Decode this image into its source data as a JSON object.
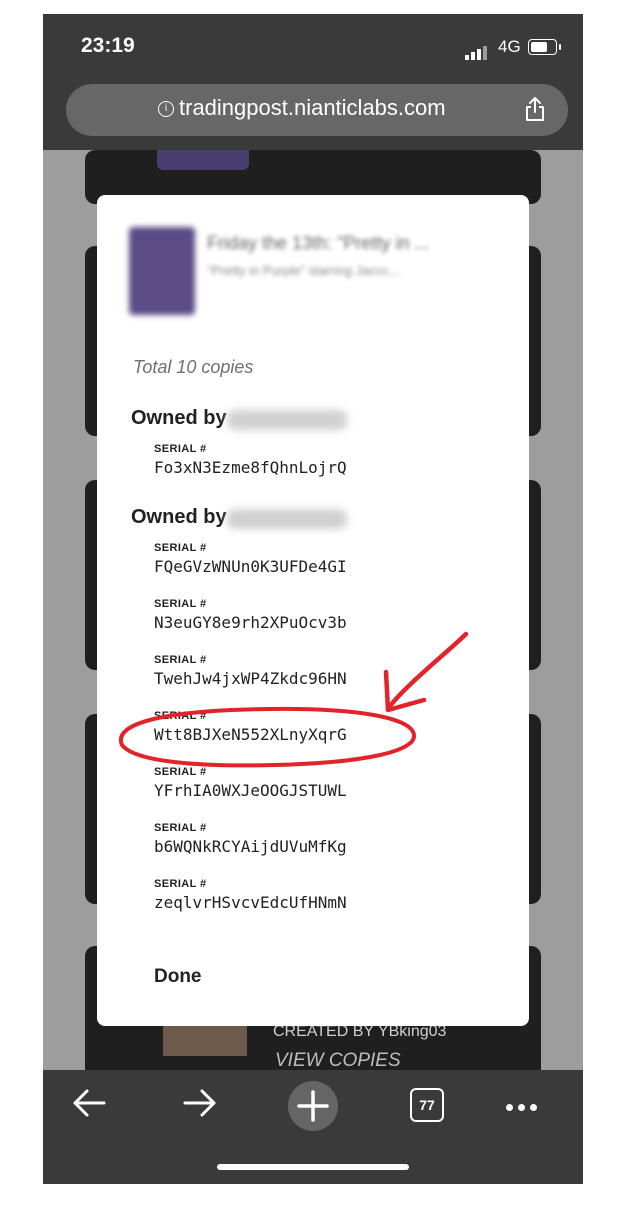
{
  "status_bar": {
    "time": "23:19",
    "network": "4G"
  },
  "browser": {
    "url": "tradingpost.nianticlabs.com"
  },
  "background_list": {
    "created_by": "CREATED BY YBking03",
    "view_copies": "VIEW COPIES"
  },
  "modal": {
    "item_title": "Friday the 13th: \"Pretty in ...",
    "item_subtitle": "\"Pretty in Purple\" starring Jaccc...",
    "total_copies": "Total 10 copies",
    "owners": [
      {
        "label": "Owned by",
        "serials": [
          "Fo3xN3Ezme8fQhnLojrQ"
        ]
      },
      {
        "label": "Owned by",
        "serials": [
          "FQeGVzWNUn0K3UFDe4GI",
          "N3euGY8e9rh2XPuOcv3b",
          "TwehJw4jxWP4Zkdc96HN",
          "Wtt8BJXeN552XLnyXqrG",
          "YFrhIA0WXJeOOGJSTUWL",
          "b6WQNkRCYAijdUVuMfKg",
          "zeqlvrHSvcvEdcUfHNmN"
        ]
      }
    ],
    "serial_label": "SERIAL #",
    "done_label": "Done",
    "highlight_color": "#e3232a"
  },
  "toolbar": {
    "tab_count": "77"
  }
}
